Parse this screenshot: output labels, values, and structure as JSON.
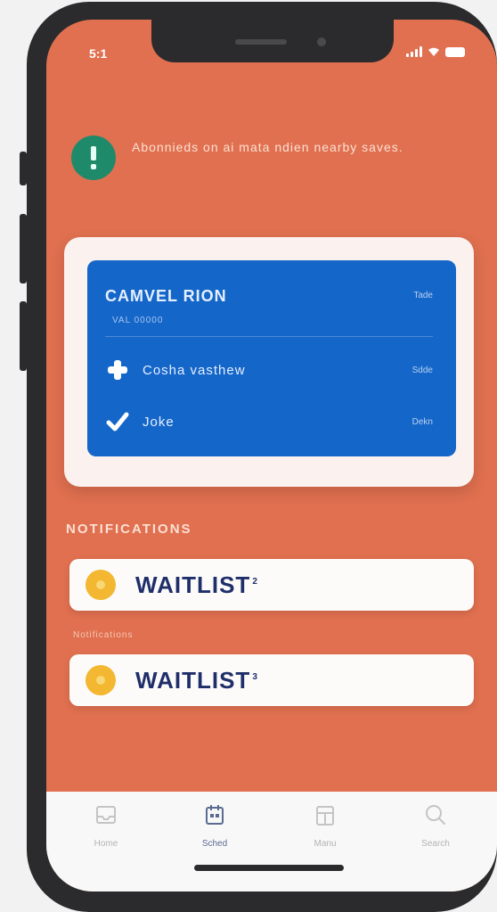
{
  "status_bar": {
    "time": "5:1"
  },
  "banner": {
    "icon": "alert-icon",
    "text": "Abonnieds on ai mata ndien nearby saves."
  },
  "card": {
    "title": "CAMVEL RION",
    "tag": "Tade",
    "subtitle": "VAL 00000",
    "rows": [
      {
        "icon": "plus-icon",
        "label": "Cosha vasthew",
        "meta": "Sdde"
      },
      {
        "icon": "check-icon",
        "label": "Joke",
        "meta": "Dekn"
      }
    ]
  },
  "notifications": {
    "section_title": "NOTIFICATIONS",
    "items": [
      {
        "text": "WAITLIST",
        "sup": "2"
      },
      {
        "text": "WAITLIST",
        "sup": "3"
      }
    ],
    "subcaption": "Notifications"
  },
  "tabbar": {
    "tabs": [
      {
        "label": "Home",
        "icon": "inbox-icon",
        "active": false
      },
      {
        "label": "Sched",
        "icon": "calendar-icon",
        "active": true
      },
      {
        "label": "Manu",
        "icon": "grid-icon",
        "active": false
      },
      {
        "label": "Search",
        "icon": "search-icon",
        "active": false
      }
    ]
  },
  "colors": {
    "screen_bg": "#e0704f",
    "card_blue": "#1466c9",
    "banner_icon_bg": "#1f8a6a",
    "coin": "#f3b731",
    "phone_frame": "#2b2b2d"
  }
}
